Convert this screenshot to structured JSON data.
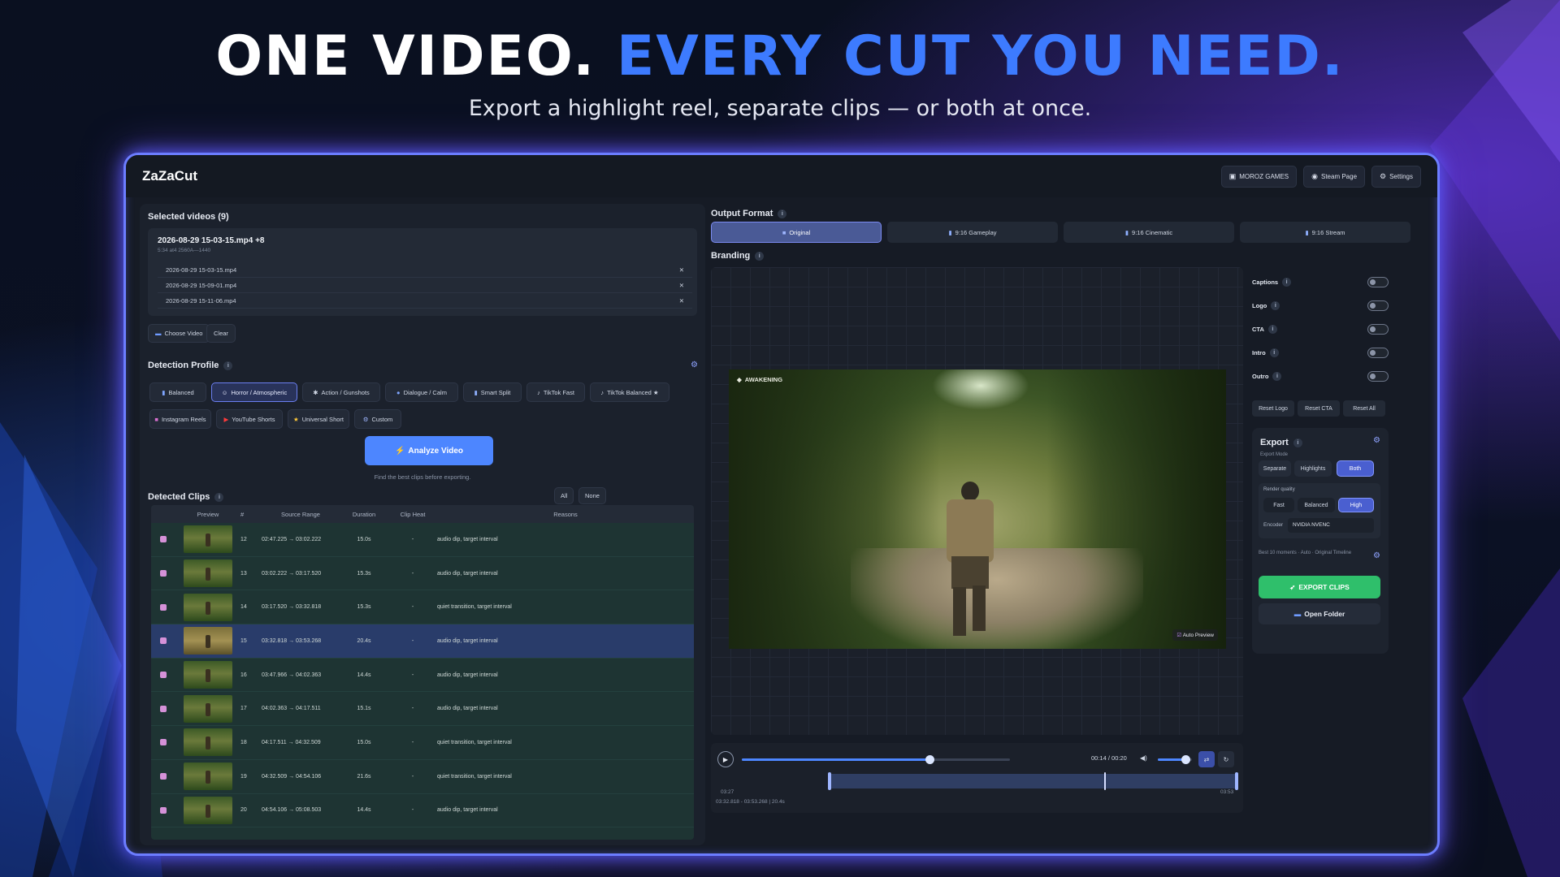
{
  "hero": {
    "title_white": "ONE VIDEO.",
    "title_blue": "EVERY CUT YOU NEED.",
    "subtitle": "Export a highlight reel, separate clips — or both at once."
  },
  "colors": {
    "accent": "#3d7bff",
    "export": "#2fbf6b",
    "frame_glow": "#6c7dff"
  },
  "app": {
    "title": "ZaZaCut",
    "top_buttons": [
      {
        "label": "MOROZ GAMES",
        "icon": "studio-icon"
      },
      {
        "label": "Steam Page",
        "icon": "steam-icon"
      },
      {
        "label": "Settings",
        "icon": "gear-icon"
      }
    ]
  },
  "selected_videos": {
    "title": "Selected videos (9)",
    "summary_name": "2026-08-29 15-03-15.mp4 +8",
    "summary_meta": "5:34 at4 2560A—1440",
    "files": [
      "2026-08-29 15-03-15.mp4",
      "2026-08-29 15-09-01.mp4",
      "2026-08-29 15-11-06.mp4"
    ],
    "choose_label": "Choose Video",
    "clear_label": "Clear"
  },
  "detection": {
    "title": "Detection Profile",
    "profiles_row1": [
      "Balanced",
      "Horror / Atmospheric",
      "Action / Gunshots",
      "Dialogue / Calm",
      "Smart Split",
      "TikTok Fast",
      "TikTok Balanced ★"
    ],
    "profiles_row2": [
      "Instagram Reels",
      "YouTube Shorts",
      "Universal Short",
      "Custom"
    ],
    "active": "Horror / Atmospheric",
    "analyze_label": "Analyze Video",
    "hint": "Find the best clips before exporting."
  },
  "clips": {
    "title": "Detected Clips",
    "all_label": "All",
    "none_label": "None",
    "headers": [
      "Preview",
      "#",
      "Source Range",
      "Duration",
      "Clip Heat",
      "Reasons"
    ],
    "rows": [
      {
        "n": "12",
        "range": "02:47.225 → 03:02.222",
        "dur": "15.0s",
        "heat": "-",
        "reason": "audio dip, target interval"
      },
      {
        "n": "13",
        "range": "03:02.222 → 03:17.520",
        "dur": "15.3s",
        "heat": "-",
        "reason": "audio dip, target interval"
      },
      {
        "n": "14",
        "range": "03:17.520 → 03:32.818",
        "dur": "15.3s",
        "heat": "-",
        "reason": "quiet transition, target interval"
      },
      {
        "n": "15",
        "range": "03:32.818 → 03:53.268",
        "dur": "20.4s",
        "heat": "-",
        "reason": "audio dip, target interval"
      },
      {
        "n": "16",
        "range": "03:47.966 → 04:02.363",
        "dur": "14.4s",
        "heat": "-",
        "reason": "audio dip, target interval"
      },
      {
        "n": "17",
        "range": "04:02.363 → 04:17.511",
        "dur": "15.1s",
        "heat": "-",
        "reason": "audio dip, target interval"
      },
      {
        "n": "18",
        "range": "04:17.511 → 04:32.509",
        "dur": "15.0s",
        "heat": "-",
        "reason": "quiet transition, target interval"
      },
      {
        "n": "19",
        "range": "04:32.509 → 04:54.106",
        "dur": "21.6s",
        "heat": "-",
        "reason": "quiet transition, target interval"
      },
      {
        "n": "20",
        "range": "04:54.106 → 05:08.503",
        "dur": "14.4s",
        "heat": "-",
        "reason": "audio dip, target interval"
      }
    ],
    "selected_row": "15"
  },
  "output": {
    "title": "Output Format",
    "formats": [
      "Original",
      "9:16 Gameplay",
      "9:16 Cinematic",
      "9:16 Stream"
    ],
    "active": "Original",
    "branding_title": "Branding"
  },
  "preview": {
    "game_title": "AWAKENING",
    "auto_preview_label": "Auto Preview",
    "time_label": "00:14 / 00:20",
    "progress": 0.7,
    "volume": 0.8,
    "range_start": "03:27",
    "range_end": "03:53",
    "range_info": "03:32.818 - 03:53.268 | 20.4s"
  },
  "branding": {
    "toggles": [
      "Captions",
      "Logo",
      "CTA",
      "Intro",
      "Outro"
    ],
    "reset_logo": "Reset Logo",
    "reset_cta": "Reset CTA",
    "reset_all": "Reset All"
  },
  "export": {
    "title": "Export",
    "mode_label": "Export Mode",
    "modes": [
      "Separate",
      "Highlights",
      "Both"
    ],
    "active_mode": "Both",
    "quality_label": "Render quality",
    "qualities": [
      "Fast",
      "Balanced",
      "High"
    ],
    "active_quality": "High",
    "encoder_label": "Encoder",
    "encoder_value": "NVIDIA NVENC",
    "summary": "Best 10 moments · Auto · Original Timeline",
    "export_label": "EXPORT CLIPS",
    "open_folder_label": "Open Folder"
  }
}
